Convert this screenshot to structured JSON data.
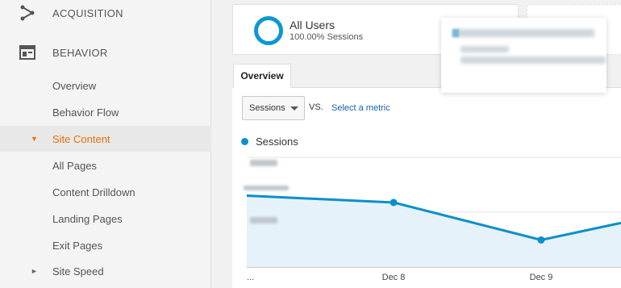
{
  "sidebar": {
    "sections": [
      {
        "label": "ACQUISITION",
        "icon": "acquisition-icon"
      },
      {
        "label": "BEHAVIOR",
        "icon": "behavior-icon"
      }
    ],
    "items": [
      {
        "label": "Overview"
      },
      {
        "label": "Behavior Flow"
      },
      {
        "label": "Site Content",
        "active": true,
        "expanded": true
      },
      {
        "label": "All Pages"
      },
      {
        "label": "Content Drilldown"
      },
      {
        "label": "Landing Pages"
      },
      {
        "label": "Exit Pages"
      },
      {
        "label": "Site Speed",
        "expanded": false
      }
    ],
    "caret_expanded": "▼",
    "caret_collapsed": "►"
  },
  "segment": {
    "title": "All Users",
    "subtitle": "100.00% Sessions"
  },
  "tabs": [
    {
      "label": "Overview"
    }
  ],
  "metric_select": {
    "value": "Sessions"
  },
  "vs_label": "VS.",
  "select_metric_link": "Select a metric",
  "legend": {
    "label": "Sessions"
  },
  "colors": {
    "accent": "#e8710a",
    "series": "#0c8fcb",
    "fill": "#e6f2f9"
  },
  "chart_data": {
    "type": "area",
    "x": [
      "…",
      "Dec 8",
      "Dec 9",
      ""
    ],
    "x_tick_labels": [
      "...",
      "Dec 8",
      "Dec 9"
    ],
    "series": [
      {
        "name": "Sessions",
        "values": [
          1.0,
          0.96,
          0.74,
          0.84
        ]
      }
    ],
    "y_tick_labels_blurred": true,
    "grid": true
  }
}
